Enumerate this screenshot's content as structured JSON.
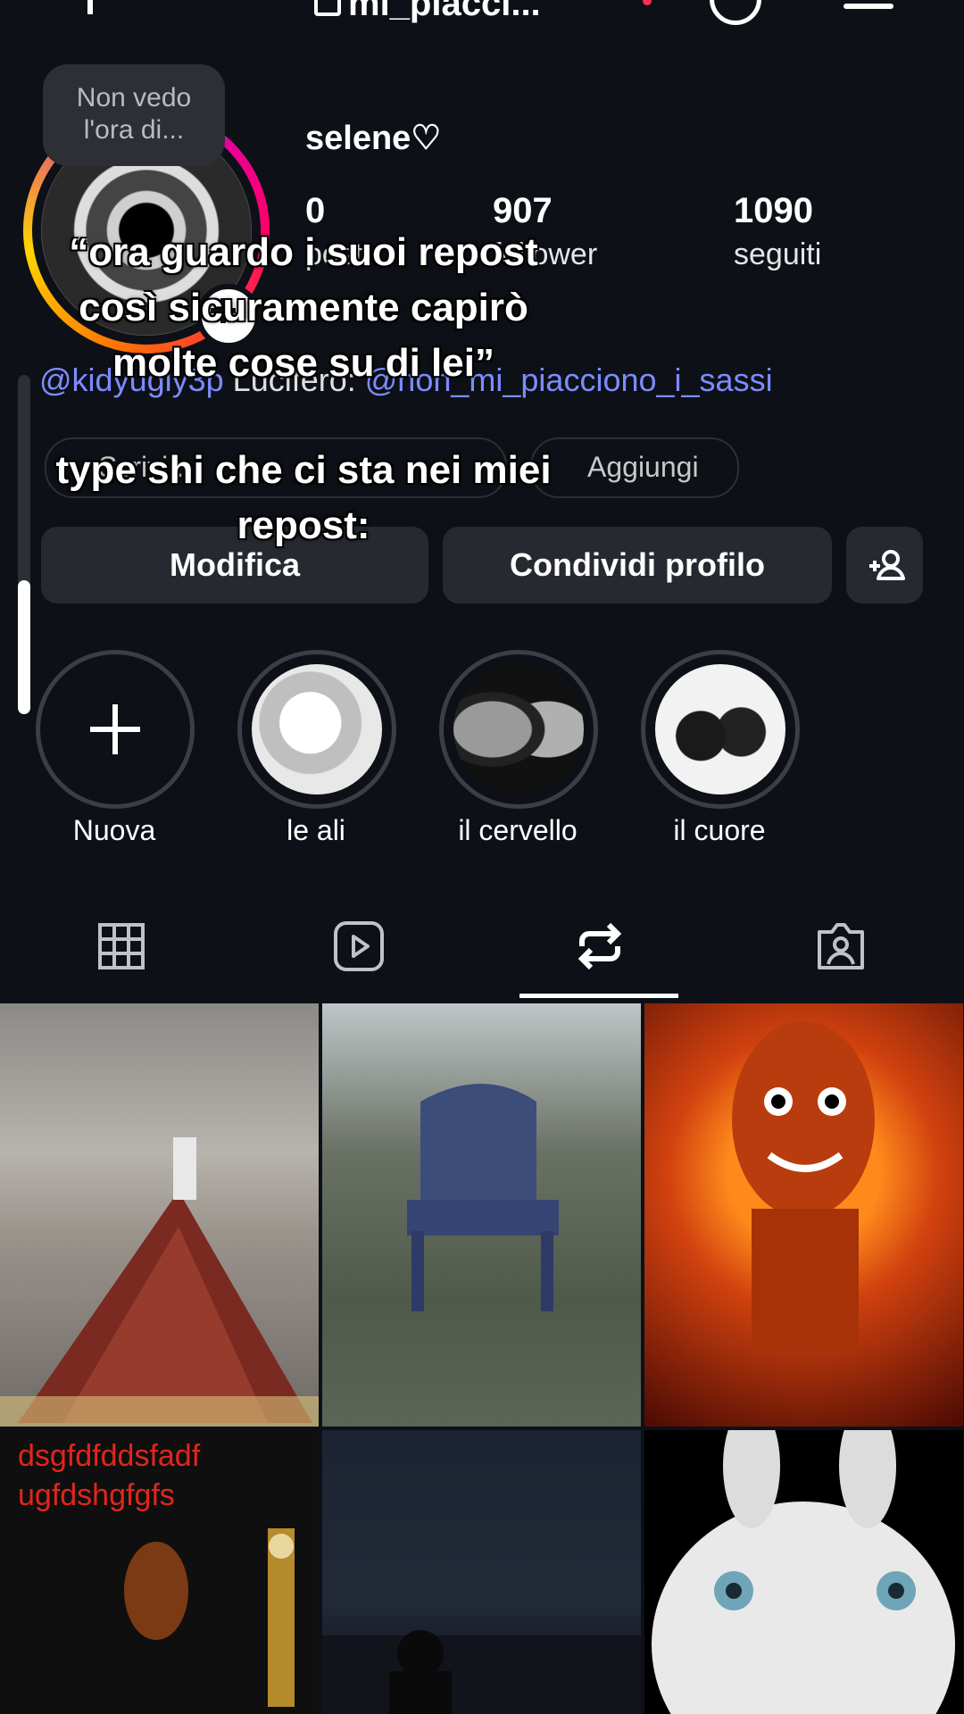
{
  "header": {
    "title": "mi_piacci...",
    "notification_color": "#ff2d55"
  },
  "profile": {
    "note": "Non vedo l'ora di...",
    "name": "selene♡",
    "stats": [
      {
        "value": "0",
        "label": "post"
      },
      {
        "value": "907",
        "label": "follower"
      },
      {
        "value": "1090",
        "label": "seguiti"
      }
    ],
    "bio_handle": "@kidyugly3p",
    "bio_name": "Lucifero:",
    "bio_link": "@non_mi_piacciono_i_sassi"
  },
  "chips": {
    "left_label": "Scrivi...",
    "right_label": "Aggiungi"
  },
  "buttons": {
    "edit": "Modifica",
    "share": "Condividi profilo"
  },
  "highlights": [
    {
      "label": "Nuova"
    },
    {
      "label": "le ali"
    },
    {
      "label": "il cervello"
    },
    {
      "label": "il cuore"
    }
  ],
  "tabs": [
    "grid-tab",
    "reels-tab",
    "reposts-tab",
    "tagged-tab"
  ],
  "grid_texts": {
    "cell4_red_text_line1": "dsgfdfddsfadf",
    "cell4_red_text_line2": "ugfdshgfgfs"
  },
  "overlay": {
    "caption1_line1": "“ora guardo i suoi repost",
    "caption1_line2": "così sicuramente capirò",
    "caption1_line3": "molte cose su di lei”",
    "caption2_line1": "type shi che ci sta nei miei",
    "caption2_line2": "repost:"
  },
  "colors": {
    "background": "#0d1117",
    "link": "#7c8cff",
    "button": "#262a30"
  }
}
